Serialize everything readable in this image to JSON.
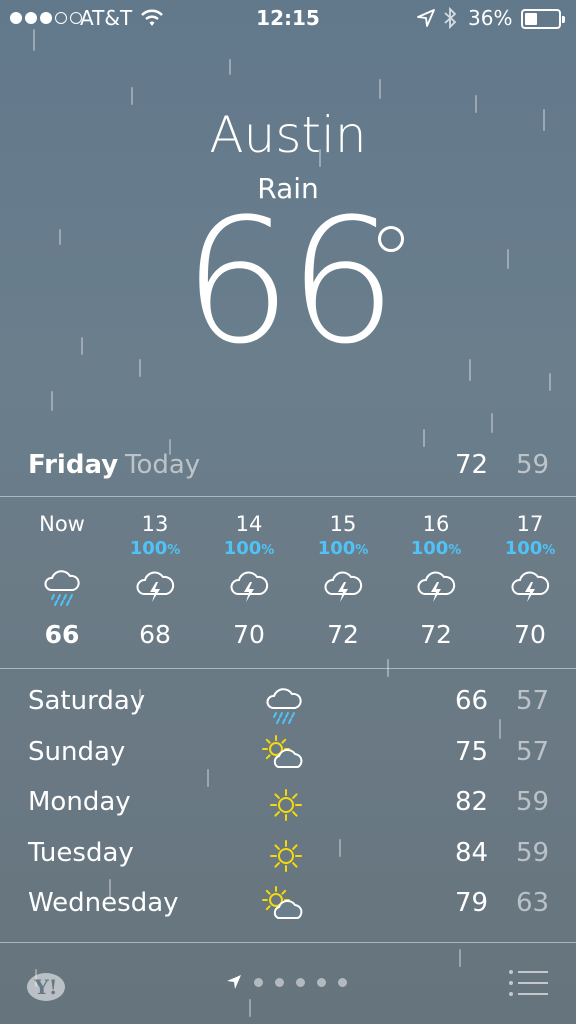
{
  "status_bar": {
    "carrier": "AT&T",
    "time": "12:15",
    "battery_percent": "36%",
    "battery_level": 0.36,
    "signal_bars_filled": 3,
    "signal_bars_total": 5
  },
  "header": {
    "city": "Austin",
    "condition": "Rain",
    "temperature": "66"
  },
  "today": {
    "day": "Friday",
    "label": "Today",
    "high": "72",
    "low": "59"
  },
  "hourly": [
    {
      "time": "Now",
      "precip": "",
      "icon": "rain-cloud-icon",
      "temp": "66"
    },
    {
      "time": "13",
      "precip": "100",
      "icon": "thunderstorm-icon",
      "temp": "68"
    },
    {
      "time": "14",
      "precip": "100",
      "icon": "thunderstorm-icon",
      "temp": "70"
    },
    {
      "time": "15",
      "precip": "100",
      "icon": "thunderstorm-icon",
      "temp": "72"
    },
    {
      "time": "16",
      "precip": "100",
      "icon": "thunderstorm-icon",
      "temp": "72"
    },
    {
      "time": "17",
      "precip": "100",
      "icon": "thunderstorm-icon",
      "temp": "70"
    }
  ],
  "percent_sign": "%",
  "daily": [
    {
      "day": "Saturday",
      "icon": "rain-cloud-icon",
      "high": "66",
      "low": "57"
    },
    {
      "day": "Sunday",
      "icon": "partly-sunny-icon",
      "high": "75",
      "low": "57"
    },
    {
      "day": "Monday",
      "icon": "sun-icon",
      "high": "82",
      "low": "59"
    },
    {
      "day": "Tuesday",
      "icon": "sun-icon",
      "high": "84",
      "low": "59"
    },
    {
      "day": "Wednesday",
      "icon": "partly-sunny-icon",
      "high": "79",
      "low": "63"
    }
  ],
  "bottom_bar": {
    "logo_text": "Y!",
    "page_dots": 5
  },
  "colors": {
    "precip_blue": "#4fc3f7",
    "sun_yellow": "#f5d90a",
    "background": "#687c8a"
  }
}
